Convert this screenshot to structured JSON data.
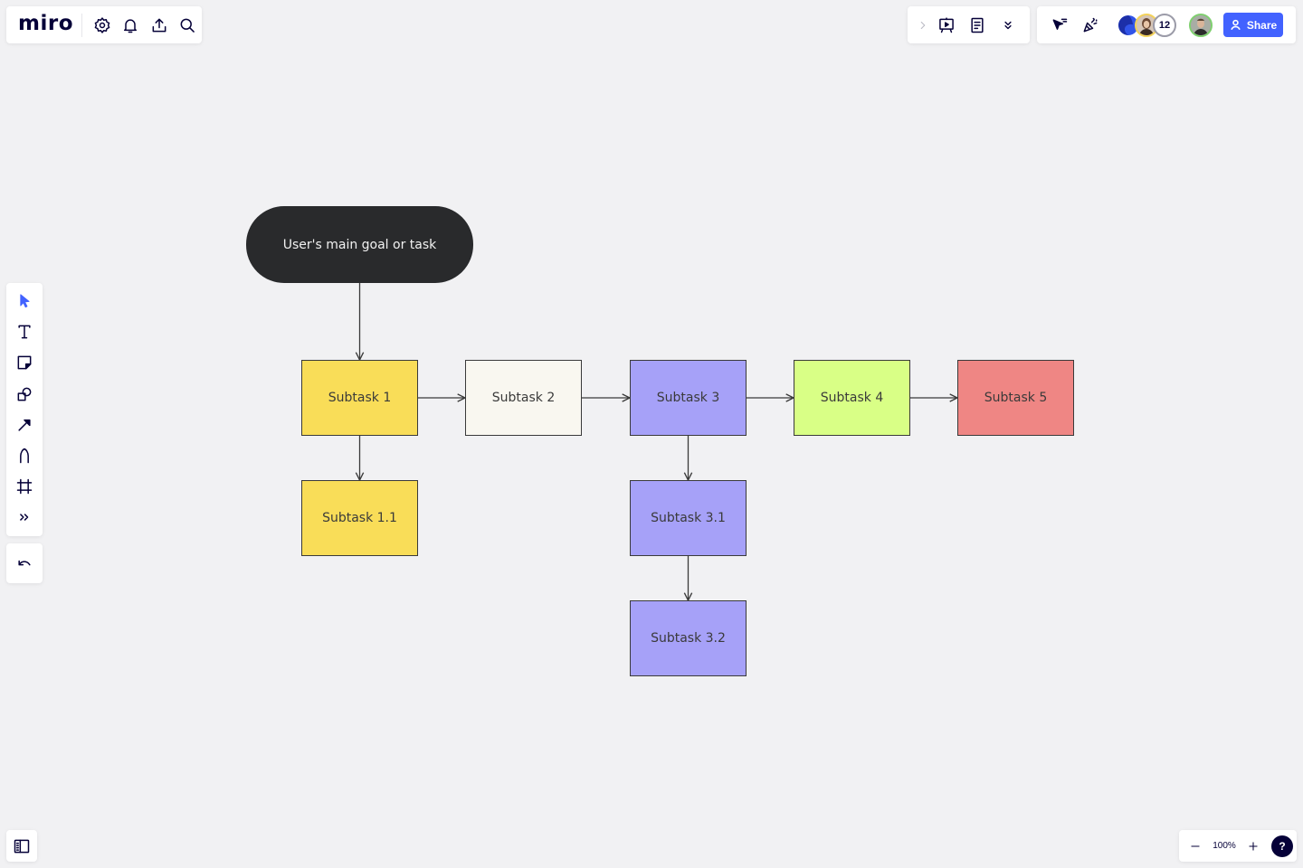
{
  "app": {
    "logo": "miro"
  },
  "top_left": {
    "icons": [
      "settings-icon",
      "notifications-icon",
      "upload-icon",
      "search-icon"
    ]
  },
  "top_right": {
    "group1": [
      "expand-chevron-icon",
      "presentation-icon",
      "notes-icon",
      "more-chevrons-icon"
    ],
    "group2": [
      "reactions-cursor-icon",
      "celebrate-icon"
    ],
    "collaborator_count": "12",
    "share_label": "Share"
  },
  "left_toolbar": {
    "tools": [
      "select-tool",
      "text-tool",
      "sticky-note-tool",
      "shapes-tool",
      "connection-line-tool",
      "pen-tool",
      "frame-tool",
      "more-tools"
    ],
    "undo": "undo-button"
  },
  "bottom_right": {
    "zoom_level": "100%",
    "help_label": "?"
  },
  "colors": {
    "accent": "#4262ff",
    "canvas_bg": "#f1f1f3",
    "yellow": "#f9dd58",
    "cream": "#f9f7f0",
    "purple": "#a6a1f8",
    "lime": "#d9ff86",
    "red": "#ef8684",
    "dark": "#292a2c"
  },
  "diagram": {
    "root": {
      "id": "root",
      "label": "User's main goal or task"
    },
    "nodes": [
      {
        "id": "s1",
        "label": "Subtask 1",
        "color": "#f9dd58"
      },
      {
        "id": "s2",
        "label": "Subtask 2",
        "color": "#f9f7f0"
      },
      {
        "id": "s3",
        "label": "Subtask 3",
        "color": "#a6a1f8"
      },
      {
        "id": "s4",
        "label": "Subtask 4",
        "color": "#d9ff86"
      },
      {
        "id": "s5",
        "label": "Subtask 5",
        "color": "#ef8684"
      },
      {
        "id": "s11",
        "label": "Subtask 1.1",
        "color": "#f9dd58"
      },
      {
        "id": "s31",
        "label": "Subtask 3.1",
        "color": "#a6a1f8"
      },
      {
        "id": "s32",
        "label": "Subtask 3.2",
        "color": "#a6a1f8"
      }
    ],
    "edges": [
      {
        "from": "root",
        "to": "s1"
      },
      {
        "from": "s1",
        "to": "s2"
      },
      {
        "from": "s2",
        "to": "s3"
      },
      {
        "from": "s3",
        "to": "s4"
      },
      {
        "from": "s4",
        "to": "s5"
      },
      {
        "from": "s1",
        "to": "s11"
      },
      {
        "from": "s3",
        "to": "s31"
      },
      {
        "from": "s31",
        "to": "s32"
      }
    ]
  }
}
